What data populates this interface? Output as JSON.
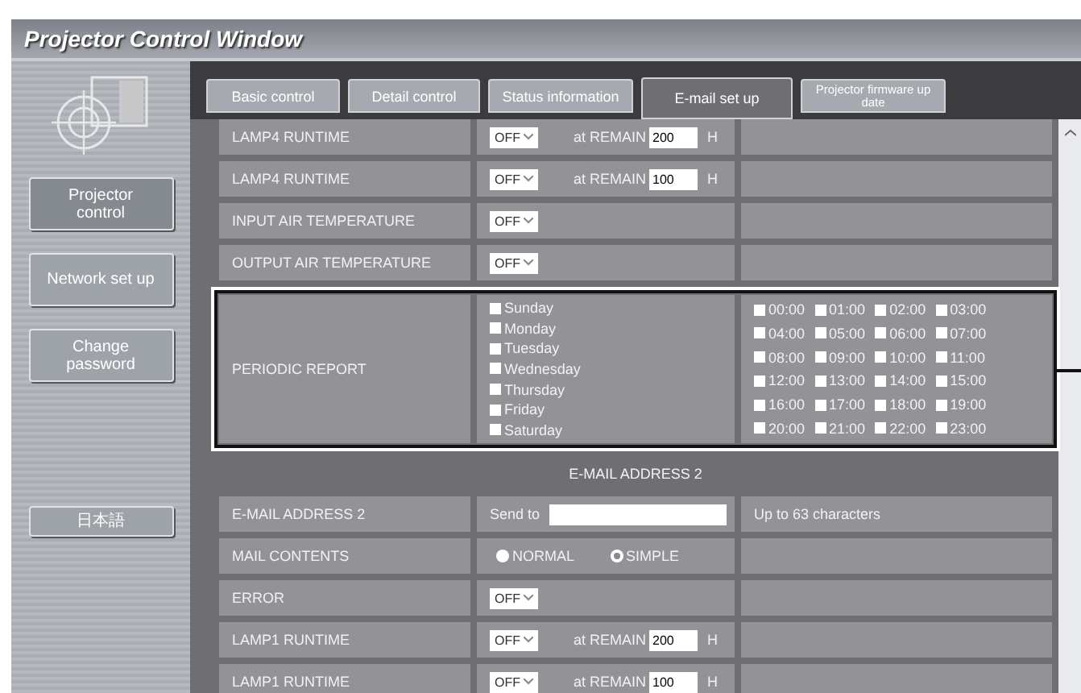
{
  "window": {
    "title": "Projector Control Window"
  },
  "sidebar": {
    "items": [
      {
        "label": "Projector control",
        "selected": true
      },
      {
        "label": "Network set up",
        "selected": false
      },
      {
        "label": "Change password",
        "selected": false
      }
    ],
    "language_button": "日本語"
  },
  "tabs": [
    {
      "label": "Basic control",
      "selected": false
    },
    {
      "label": "Detail control",
      "selected": false
    },
    {
      "label": "Status information",
      "selected": false
    },
    {
      "label": "E-mail set up",
      "selected": true
    },
    {
      "label": "Projector firmware up date",
      "selected": false
    }
  ],
  "rows_top": [
    {
      "kind": "threshold",
      "label": "LAMP4 RUNTIME",
      "select": "OFF",
      "remain_label": "at REMAIN",
      "value": "200",
      "unit": "H"
    },
    {
      "kind": "threshold",
      "label": "LAMP4 RUNTIME",
      "select": "OFF",
      "remain_label": "at REMAIN",
      "value": "100",
      "unit": "H"
    },
    {
      "kind": "select",
      "label": "INPUT AIR TEMPERATURE",
      "select": "OFF"
    },
    {
      "kind": "select",
      "label": "OUTPUT AIR TEMPERATURE",
      "select": "OFF"
    },
    {
      "kind": "periodic",
      "label": "PERIODIC REPORT",
      "highlighted": true,
      "days": [
        {
          "label": "Sunday",
          "checked": false
        },
        {
          "label": "Monday",
          "checked": false
        },
        {
          "label": "Tuesday",
          "checked": false
        },
        {
          "label": "Wednesday",
          "checked": false
        },
        {
          "label": "Thursday",
          "checked": false
        },
        {
          "label": "Friday",
          "checked": false
        },
        {
          "label": "Saturday",
          "checked": false
        }
      ],
      "hours": [
        {
          "label": "00:00",
          "checked": false
        },
        {
          "label": "01:00",
          "checked": false
        },
        {
          "label": "02:00",
          "checked": false
        },
        {
          "label": "03:00",
          "checked": false
        },
        {
          "label": "04:00",
          "checked": false
        },
        {
          "label": "05:00",
          "checked": false
        },
        {
          "label": "06:00",
          "checked": false
        },
        {
          "label": "07:00",
          "checked": false
        },
        {
          "label": "08:00",
          "checked": false
        },
        {
          "label": "09:00",
          "checked": false
        },
        {
          "label": "10:00",
          "checked": false
        },
        {
          "label": "11:00",
          "checked": false
        },
        {
          "label": "12:00",
          "checked": false
        },
        {
          "label": "13:00",
          "checked": false
        },
        {
          "label": "14:00",
          "checked": false
        },
        {
          "label": "15:00",
          "checked": false
        },
        {
          "label": "16:00",
          "checked": false
        },
        {
          "label": "17:00",
          "checked": false
        },
        {
          "label": "18:00",
          "checked": false
        },
        {
          "label": "19:00",
          "checked": false
        },
        {
          "label": "20:00",
          "checked": false
        },
        {
          "label": "21:00",
          "checked": false
        },
        {
          "label": "22:00",
          "checked": false
        },
        {
          "label": "23:00",
          "checked": false
        }
      ]
    }
  ],
  "section_heading": "E-MAIL ADDRESS 2",
  "rows_bottom": [
    {
      "kind": "email",
      "label": "E-MAIL ADDRESS 2",
      "prefix": "Send to",
      "note": "Up to 63 characters"
    },
    {
      "kind": "radio",
      "label": "MAIL CONTENTS",
      "options": [
        {
          "label": "NORMAL",
          "selected": false
        },
        {
          "label": "SIMPLE",
          "selected": true
        }
      ]
    },
    {
      "kind": "select",
      "label": "ERROR",
      "select": "OFF"
    },
    {
      "kind": "threshold",
      "label": "LAMP1 RUNTIME",
      "select": "OFF",
      "remain_label": "at REMAIN",
      "value": "200",
      "unit": "H"
    },
    {
      "kind": "threshold",
      "label": "LAMP1 RUNTIME",
      "select": "OFF",
      "remain_label": "at REMAIN",
      "value": "100",
      "unit": "H"
    }
  ]
}
